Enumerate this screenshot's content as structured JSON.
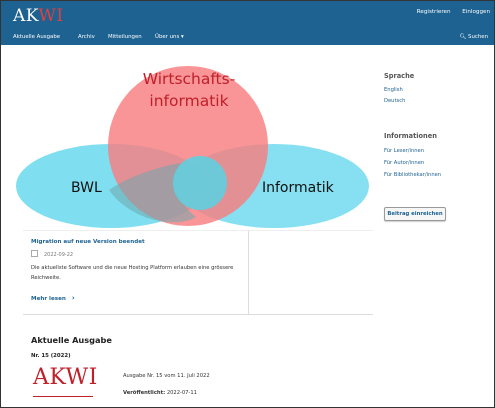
{
  "header": {
    "logo_left": "AK",
    "logo_right": "WI",
    "register_label": "Registrieren",
    "login_label": "Einloggen"
  },
  "nav": {
    "items": [
      "Aktuelle Ausgabe",
      "Archiv",
      "Mitteilungen",
      "Über uns ▾"
    ],
    "search_label": "Suchen"
  },
  "hero": {
    "circle_top_line1": "Wirtschafts-",
    "circle_top_line2": "informatik",
    "circle_left": "BWL",
    "circle_right": "Informatik",
    "colors": {
      "top": "#f87e80",
      "left": "#7fdef0",
      "right": "#7fdef0",
      "overlap": "#6fa7ad"
    }
  },
  "announcement": {
    "title": "Migration auf neue Version beendet",
    "date": "2022-09-22",
    "body": "Die aktuellste Software und die neue Hosting Platform erlauben eine grössere Reichweite.",
    "more_label": "Mehr lesen"
  },
  "current_issue": {
    "heading": "Aktuelle Ausgabe",
    "number": "Nr. 15 (2022)",
    "cover_left": "AK",
    "cover_right": "WI",
    "description": "Ausgabe Nr. 15 vom 11. Juli 2022",
    "published_label": "Veröffentlicht:",
    "published_date": "2022-07-11"
  },
  "sidebar": {
    "language_heading": "Sprache",
    "languages": [
      "English",
      "Deutsch"
    ],
    "info_heading": "Informationen",
    "info_links": [
      "Für Leser/innen",
      "Für Autor/innen",
      "Für Bibliothekar/innen"
    ],
    "submit_label": "Beitrag einreichen"
  }
}
